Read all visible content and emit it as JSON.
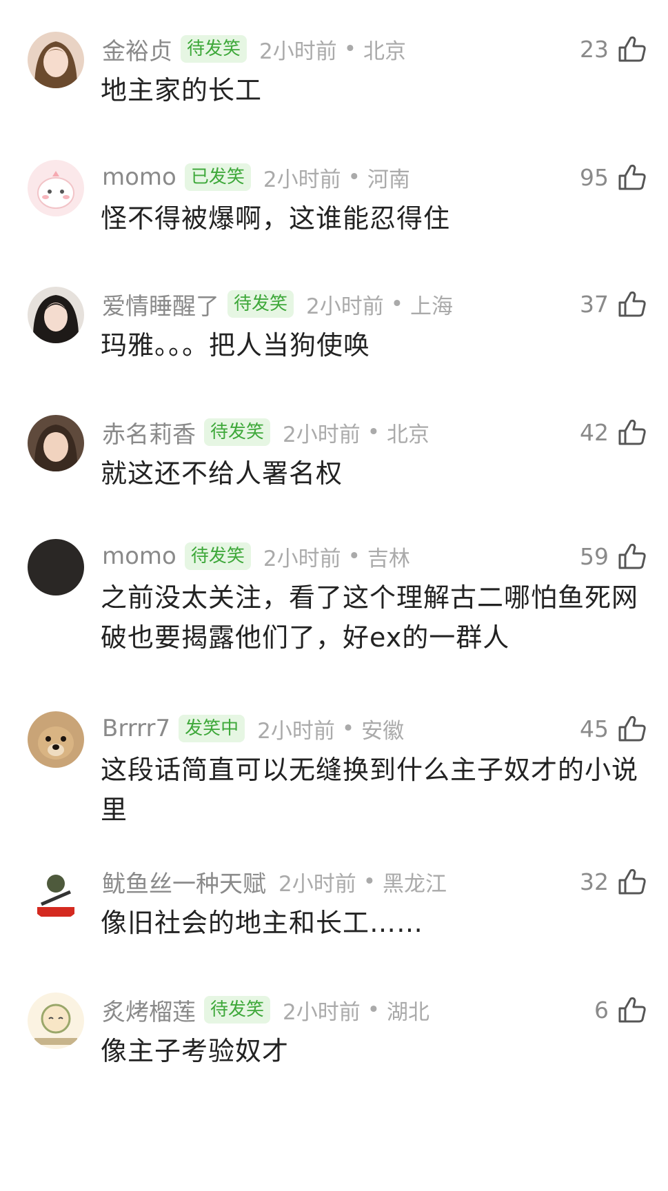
{
  "comments": [
    {
      "username": "金裕贞",
      "badge": "待发笑",
      "time": "2小时前",
      "location": "北京",
      "likes": "23",
      "text": "地主家的长工"
    },
    {
      "username": "momo",
      "badge": "已发笑",
      "time": "2小时前",
      "location": "河南",
      "likes": "95",
      "text": "怪不得被爆啊，这谁能忍得住"
    },
    {
      "username": "爱情睡醒了",
      "badge": "待发笑",
      "time": "2小时前",
      "location": "上海",
      "likes": "37",
      "text": "玛雅。。。把人当狗使唤"
    },
    {
      "username": "赤名莉香",
      "badge": "待发笑",
      "time": "2小时前",
      "location": "北京",
      "likes": "42",
      "text": "就这还不给人署名权"
    },
    {
      "username": "momo",
      "badge": "待发笑",
      "time": "2小时前",
      "location": "吉林",
      "likes": "59",
      "text": "之前没太关注，看了这个理解古二哪怕鱼死网破也要揭露他们了，好ex的一群人"
    },
    {
      "username": "Brrrr7",
      "badge": "发笑中",
      "time": "2小时前",
      "location": "安徽",
      "likes": "45",
      "text": "这段话简直可以无缝换到什么主子奴才的小说里"
    },
    {
      "username": "鱿鱼丝一种天赋",
      "badge": "",
      "time": "2小时前",
      "location": "黑龙江",
      "likes": "32",
      "text": "像旧社会的地主和长工……"
    },
    {
      "username": "炙烤榴莲",
      "badge": "待发笑",
      "time": "2小时前",
      "location": "湖北",
      "likes": "6",
      "text": "像主子考验奴才"
    }
  ],
  "separator": "•",
  "icons": {
    "like": "thumbs-up-icon"
  },
  "colors": {
    "badge_bg": "#e6f6e3",
    "badge_text": "#3ea83a",
    "meta": "#aaaaaa",
    "text": "#222222"
  }
}
